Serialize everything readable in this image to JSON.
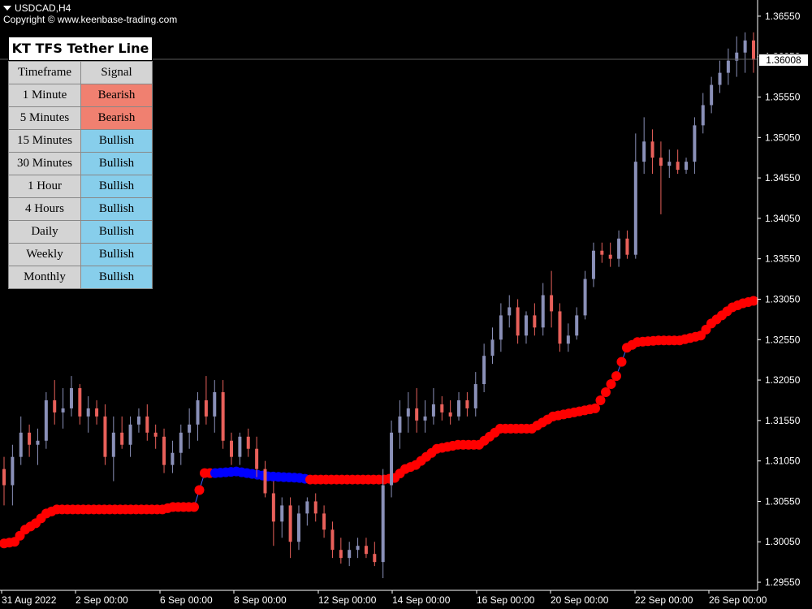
{
  "header": {
    "symbol": "USDCAD,H4",
    "copyright": "Copyright © www.keenbase-trading.com"
  },
  "panel": {
    "title": "KT TFS Tether Line",
    "col_timeframe": "Timeframe",
    "col_signal": "Signal",
    "rows": [
      {
        "tf": "1 Minute",
        "signal": "Bearish"
      },
      {
        "tf": "5 Minutes",
        "signal": "Bearish"
      },
      {
        "tf": "15 Minutes",
        "signal": "Bullish"
      },
      {
        "tf": "30 Minutes",
        "signal": "Bullish"
      },
      {
        "tf": "1 Hour",
        "signal": "Bullish"
      },
      {
        "tf": "4 Hours",
        "signal": "Bullish"
      },
      {
        "tf": "Daily",
        "signal": "Bullish"
      },
      {
        "tf": "Weekly",
        "signal": "Bullish"
      },
      {
        "tf": "Monthly",
        "signal": "Bullish"
      }
    ]
  },
  "current_price": "1.36008",
  "colors": {
    "bull_candle": "#8a90b8",
    "bear_candle": "#e8605a",
    "tether_bear": "#ff0000",
    "tether_bull": "#0000ff",
    "bearish_cell": "#f08070",
    "bullish_cell": "#87ceeb"
  },
  "chart_data": {
    "type": "candlestick",
    "y_ticks": [
      "1.36550",
      "1.36050",
      "1.35550",
      "1.35050",
      "1.34550",
      "1.34050",
      "1.33550",
      "1.33050",
      "1.32550",
      "1.32050",
      "1.31550",
      "1.31050",
      "1.30550",
      "1.30050",
      "1.29550"
    ],
    "x_ticks": [
      "31 Aug 2022",
      "2 Sep 00:00",
      "6 Sep 00:00",
      "8 Sep 00:00",
      "12 Sep 00:00",
      "14 Sep 00:00",
      "16 Sep 00:00",
      "20 Sep 00:00",
      "22 Sep 00:00",
      "26 Sep 00:00"
    ],
    "ylim": [
      1.2945,
      1.3675
    ],
    "candles": [
      [
        1.3095,
        1.311,
        1.305,
        1.3075
      ],
      [
        1.3075,
        1.3125,
        1.305,
        1.311
      ],
      [
        1.311,
        1.316,
        1.31,
        1.314
      ],
      [
        1.314,
        1.315,
        1.311,
        1.3125
      ],
      [
        1.3125,
        1.3145,
        1.31,
        1.313
      ],
      [
        1.313,
        1.319,
        1.312,
        1.318
      ],
      [
        1.318,
        1.3205,
        1.315,
        1.3165
      ],
      [
        1.3165,
        1.3195,
        1.3145,
        1.317
      ],
      [
        1.317,
        1.321,
        1.316,
        1.3195
      ],
      [
        1.3195,
        1.32,
        1.315,
        1.316
      ],
      [
        1.316,
        1.3185,
        1.314,
        1.317
      ],
      [
        1.317,
        1.318,
        1.315,
        1.316
      ],
      [
        1.316,
        1.3175,
        1.31,
        1.311
      ],
      [
        1.311,
        1.316,
        1.308,
        1.314
      ],
      [
        1.314,
        1.316,
        1.312,
        1.3125
      ],
      [
        1.3125,
        1.316,
        1.311,
        1.315
      ],
      [
        1.315,
        1.317,
        1.314,
        1.316
      ],
      [
        1.316,
        1.3175,
        1.313,
        1.314
      ],
      [
        1.314,
        1.315,
        1.312,
        1.3135
      ],
      [
        1.3135,
        1.3145,
        1.309,
        1.31
      ],
      [
        1.31,
        1.313,
        1.309,
        1.3115
      ],
      [
        1.3115,
        1.315,
        1.31,
        1.314
      ],
      [
        1.314,
        1.317,
        1.312,
        1.315
      ],
      [
        1.315,
        1.319,
        1.313,
        1.318
      ],
      [
        1.318,
        1.321,
        1.315,
        1.316
      ],
      [
        1.316,
        1.3205,
        1.314,
        1.319
      ],
      [
        1.319,
        1.3205,
        1.312,
        1.313
      ],
      [
        1.313,
        1.314,
        1.31,
        1.311
      ],
      [
        1.311,
        1.314,
        1.31,
        1.3135
      ],
      [
        1.3135,
        1.3145,
        1.311,
        1.312
      ],
      [
        1.312,
        1.3135,
        1.3085,
        1.3095
      ],
      [
        1.3095,
        1.3105,
        1.306,
        1.3065
      ],
      [
        1.3065,
        1.308,
        1.3,
        1.303
      ],
      [
        1.303,
        1.306,
        1.301,
        1.305
      ],
      [
        1.305,
        1.306,
        1.2985,
        1.3005
      ],
      [
        1.3005,
        1.305,
        1.2995,
        1.304
      ],
      [
        1.304,
        1.306,
        1.3025,
        1.3055
      ],
      [
        1.3055,
        1.3065,
        1.303,
        1.304
      ],
      [
        1.304,
        1.305,
        1.301,
        1.302
      ],
      [
        1.302,
        1.303,
        1.2985,
        1.2995
      ],
      [
        1.2995,
        1.301,
        1.2978,
        1.2985
      ],
      [
        1.2985,
        1.3005,
        1.2975,
        1.2995
      ],
      [
        1.2995,
        1.301,
        1.2985,
        1.3
      ],
      [
        1.3,
        1.301,
        1.2985,
        1.299
      ],
      [
        1.299,
        1.3005,
        1.2975,
        1.298
      ],
      [
        1.298,
        1.3095,
        1.296,
        1.3075
      ],
      [
        1.3075,
        1.3155,
        1.306,
        1.314
      ],
      [
        1.314,
        1.318,
        1.312,
        1.316
      ],
      [
        1.316,
        1.319,
        1.314,
        1.317
      ],
      [
        1.317,
        1.3195,
        1.314,
        1.3155
      ],
      [
        1.3155,
        1.318,
        1.314,
        1.316
      ],
      [
        1.316,
        1.3195,
        1.315,
        1.3175
      ],
      [
        1.3175,
        1.3185,
        1.3155,
        1.3165
      ],
      [
        1.3165,
        1.318,
        1.315,
        1.316
      ],
      [
        1.316,
        1.319,
        1.3155,
        1.318
      ],
      [
        1.318,
        1.319,
        1.316,
        1.317
      ],
      [
        1.317,
        1.3215,
        1.316,
        1.32
      ],
      [
        1.32,
        1.325,
        1.319,
        1.3235
      ],
      [
        1.3235,
        1.327,
        1.3225,
        1.3255
      ],
      [
        1.3255,
        1.33,
        1.324,
        1.3285
      ],
      [
        1.3285,
        1.331,
        1.327,
        1.3295
      ],
      [
        1.3295,
        1.3305,
        1.325,
        1.326
      ],
      [
        1.326,
        1.329,
        1.325,
        1.3285
      ],
      [
        1.3285,
        1.33,
        1.326,
        1.327
      ],
      [
        1.327,
        1.3325,
        1.326,
        1.331
      ],
      [
        1.331,
        1.334,
        1.327,
        1.329
      ],
      [
        1.329,
        1.33,
        1.324,
        1.325
      ],
      [
        1.325,
        1.3275,
        1.324,
        1.326
      ],
      [
        1.326,
        1.3295,
        1.3255,
        1.3285
      ],
      [
        1.3285,
        1.334,
        1.328,
        1.333
      ],
      [
        1.333,
        1.3375,
        1.332,
        1.3365
      ],
      [
        1.3365,
        1.3375,
        1.335,
        1.336
      ],
      [
        1.336,
        1.3375,
        1.3345,
        1.3355
      ],
      [
        1.3355,
        1.339,
        1.3345,
        1.338
      ],
      [
        1.338,
        1.339,
        1.3355,
        1.336
      ],
      [
        1.336,
        1.351,
        1.3355,
        1.3475
      ],
      [
        1.3475,
        1.353,
        1.346,
        1.35
      ],
      [
        1.35,
        1.3515,
        1.346,
        1.348
      ],
      [
        1.348,
        1.35,
        1.341,
        1.347
      ],
      [
        1.347,
        1.349,
        1.3455,
        1.3475
      ],
      [
        1.3475,
        1.349,
        1.346,
        1.3465
      ],
      [
        1.3465,
        1.348,
        1.346,
        1.3475
      ],
      [
        1.3475,
        1.353,
        1.346,
        1.352
      ],
      [
        1.352,
        1.356,
        1.351,
        1.3545
      ],
      [
        1.3545,
        1.358,
        1.3535,
        1.357
      ],
      [
        1.357,
        1.36,
        1.356,
        1.3585
      ],
      [
        1.3585,
        1.3615,
        1.357,
        1.36
      ],
      [
        1.36,
        1.363,
        1.358,
        1.361
      ],
      [
        1.361,
        1.3635,
        1.3585,
        1.3625
      ],
      [
        1.3625,
        1.3635,
        1.3585,
        1.3601
      ]
    ],
    "tether": [
      [
        0,
        1.3003,
        "r"
      ],
      [
        2,
        1.3005,
        "r"
      ],
      [
        4,
        1.302,
        "r"
      ],
      [
        6,
        1.3028,
        "r"
      ],
      [
        8,
        1.304,
        "r"
      ],
      [
        10,
        1.3045,
        "r"
      ],
      [
        12,
        1.3045,
        "r"
      ],
      [
        30,
        1.3045,
        "r"
      ],
      [
        32,
        1.3048,
        "r"
      ],
      [
        36,
        1.3048,
        "r"
      ],
      [
        38,
        1.309,
        "r"
      ],
      [
        40,
        1.309,
        "b"
      ],
      [
        44,
        1.3092,
        "b"
      ],
      [
        46,
        1.309,
        "b"
      ],
      [
        50,
        1.3086,
        "b"
      ],
      [
        56,
        1.3084,
        "b"
      ],
      [
        58,
        1.3082,
        "r"
      ],
      [
        72,
        1.3082,
        "r"
      ],
      [
        74,
        1.3084,
        "r"
      ],
      [
        76,
        1.3095,
        "r"
      ],
      [
        78,
        1.31,
        "r"
      ],
      [
        82,
        1.312,
        "r"
      ],
      [
        86,
        1.3125,
        "r"
      ],
      [
        90,
        1.3125,
        "r"
      ],
      [
        94,
        1.3145,
        "r"
      ],
      [
        100,
        1.3145,
        "r"
      ],
      [
        104,
        1.316,
        "r"
      ],
      [
        108,
        1.3165,
        "r"
      ],
      [
        112,
        1.317,
        "r"
      ],
      [
        116,
        1.321,
        "r"
      ],
      [
        118,
        1.3245,
        "r"
      ],
      [
        120,
        1.3252,
        "r"
      ],
      [
        124,
        1.3254,
        "r"
      ],
      [
        128,
        1.3254,
        "r"
      ],
      [
        132,
        1.326,
        "r"
      ],
      [
        134,
        1.3275,
        "r"
      ],
      [
        136,
        1.3285,
        "r"
      ],
      [
        138,
        1.3295,
        "r"
      ],
      [
        140,
        1.33,
        "r"
      ],
      [
        142,
        1.3303,
        "r"
      ]
    ]
  }
}
